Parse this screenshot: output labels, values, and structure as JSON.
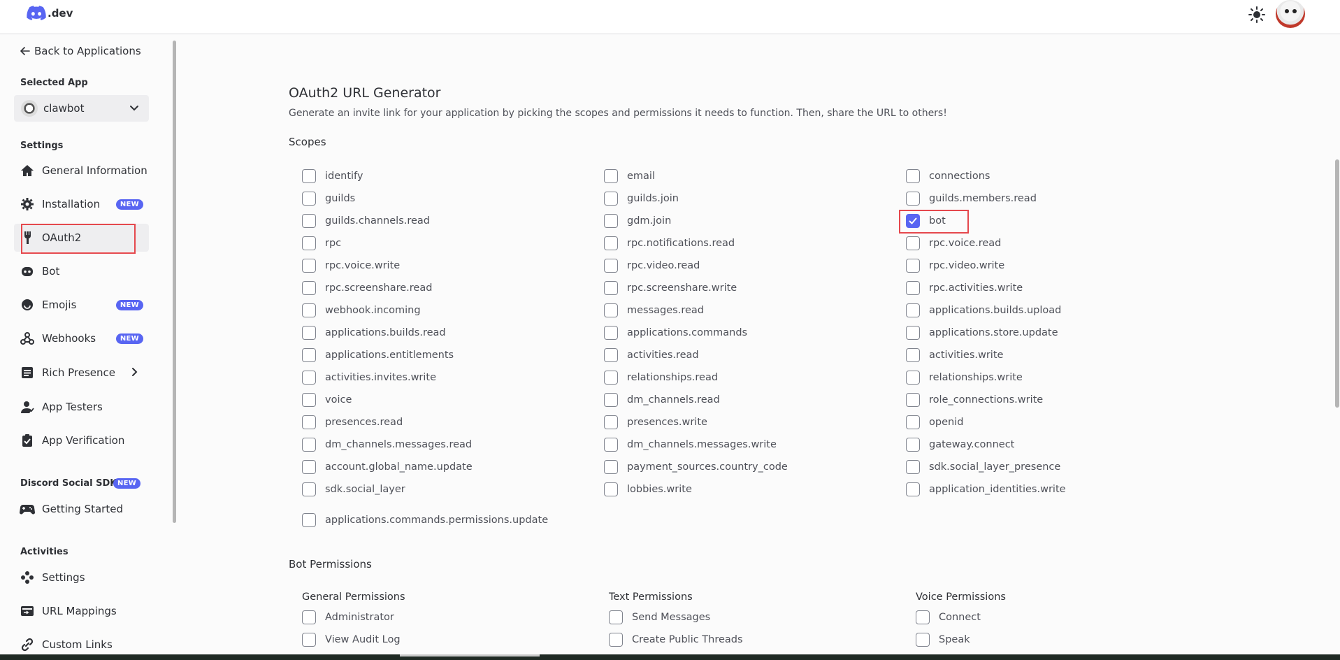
{
  "header": {
    "logo_text": ".dev",
    "theme_icon": "sun-icon",
    "avatar_icon": "user-avatar"
  },
  "sidebar": {
    "back_label": "Back to Applications",
    "selected_app_label": "Selected App",
    "app_name": "clawbot",
    "settings_label": "Settings",
    "items": [
      {
        "label": "General Information",
        "icon": "home-icon",
        "badge": ""
      },
      {
        "label": "Installation",
        "icon": "gear-icon",
        "badge": "NEW"
      },
      {
        "label": "OAuth2",
        "icon": "wrench-icon",
        "badge": ""
      },
      {
        "label": "Bot",
        "icon": "bot-icon",
        "badge": ""
      },
      {
        "label": "Emojis",
        "icon": "smile-icon",
        "badge": "NEW"
      },
      {
        "label": "Webhooks",
        "icon": "webhook-icon",
        "badge": "NEW"
      },
      {
        "label": "Rich Presence",
        "icon": "list-icon",
        "badge": ""
      },
      {
        "label": "App Testers",
        "icon": "person-icon",
        "badge": ""
      },
      {
        "label": "App Verification",
        "icon": "clipboard-check-icon",
        "badge": ""
      }
    ],
    "social_sdk_label": "Discord Social SDK",
    "social_sdk_badge": "NEW",
    "social_items": [
      {
        "label": "Getting Started",
        "icon": "gamepad-icon"
      }
    ],
    "activities_label": "Activities",
    "activity_items": [
      {
        "label": "Settings",
        "icon": "dpad-icon"
      },
      {
        "label": "URL Mappings",
        "icon": "url-map-icon"
      },
      {
        "label": "Custom Links",
        "icon": "link-icon"
      }
    ]
  },
  "main": {
    "title": "OAuth2 URL Generator",
    "description": "Generate an invite link for your application by picking the scopes and permissions it needs to function. Then, share the URL to others!",
    "scopes_label": "Scopes",
    "scopes": {
      "col1": [
        "identify",
        "guilds",
        "guilds.channels.read",
        "rpc",
        "rpc.voice.write",
        "rpc.screenshare.read",
        "webhook.incoming",
        "applications.builds.read",
        "applications.entitlements",
        "activities.invites.write",
        "voice",
        "presences.read",
        "dm_channels.messages.read",
        "account.global_name.update",
        "sdk.social_layer"
      ],
      "col2": [
        "email",
        "guilds.join",
        "gdm.join",
        "rpc.notifications.read",
        "rpc.video.read",
        "rpc.screenshare.write",
        "messages.read",
        "applications.commands",
        "activities.read",
        "relationships.read",
        "dm_channels.read",
        "presences.write",
        "dm_channels.messages.write",
        "payment_sources.country_code",
        "lobbies.write"
      ],
      "col3": [
        "connections",
        "guilds.members.read",
        "bot",
        "rpc.voice.read",
        "rpc.video.write",
        "rpc.activities.write",
        "applications.builds.upload",
        "applications.store.update",
        "activities.write",
        "relationships.write",
        "role_connections.write",
        "openid",
        "gateway.connect",
        "sdk.social_layer_presence",
        "application_identities.write"
      ],
      "extra": "applications.commands.permissions.update",
      "checked": [
        "bot"
      ]
    },
    "bot_permissions_label": "Bot Permissions",
    "permission_groups": [
      {
        "title": "General Permissions",
        "items": [
          "Administrator",
          "View Audit Log"
        ]
      },
      {
        "title": "Text Permissions",
        "items": [
          "Send Messages",
          "Create Public Threads"
        ]
      },
      {
        "title": "Voice Permissions",
        "items": [
          "Connect",
          "Speak"
        ]
      }
    ]
  },
  "colors": {
    "accent": "#5865f2",
    "highlight": "#e5484d"
  }
}
